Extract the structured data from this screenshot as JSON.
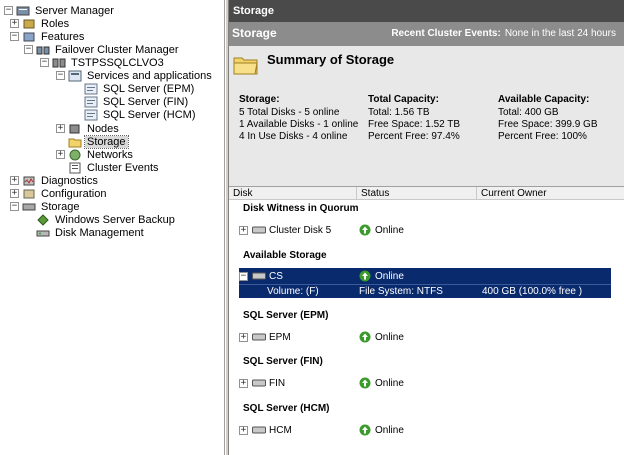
{
  "tree": {
    "items": [
      {
        "label": "Server Manager",
        "expander": "−",
        "icon": "server-manager-icon"
      },
      {
        "label": "Roles",
        "expander": "+",
        "icon": "roles-icon"
      },
      {
        "label": "Features",
        "expander": "−",
        "icon": "features-icon"
      },
      {
        "label": "Failover Cluster Manager",
        "expander": "−",
        "icon": "cluster-manager-icon"
      },
      {
        "label": "TSTPSSQLCLVO3",
        "expander": "−",
        "icon": "cluster-icon"
      },
      {
        "label": "Services and applications",
        "expander": "−",
        "icon": "services-icon"
      },
      {
        "label": "SQL Server (EPM)",
        "expander": "",
        "icon": "service-icon"
      },
      {
        "label": "SQL Server (FIN)",
        "expander": "",
        "icon": "service-icon"
      },
      {
        "label": "SQL Server (HCM)",
        "expander": "",
        "icon": "service-icon"
      },
      {
        "label": "Nodes",
        "expander": "+",
        "icon": "nodes-icon"
      },
      {
        "label": "Storage",
        "expander": "",
        "icon": "storage-icon"
      },
      {
        "label": "Networks",
        "expander": "+",
        "icon": "networks-icon"
      },
      {
        "label": "Cluster Events",
        "expander": "",
        "icon": "events-icon"
      },
      {
        "label": "Diagnostics",
        "expander": "+",
        "icon": "diagnostics-icon"
      },
      {
        "label": "Configuration",
        "expander": "+",
        "icon": "configuration-icon"
      },
      {
        "label": "Storage",
        "expander": "−",
        "icon": "storage-root-icon"
      },
      {
        "label": "Windows Server Backup",
        "expander": "",
        "icon": "backup-icon"
      },
      {
        "label": "Disk Management",
        "expander": "",
        "icon": "disk-management-icon"
      }
    ]
  },
  "pane": {
    "title": "Storage",
    "header": "Storage",
    "events_label": "Recent Cluster Events:",
    "events_value": "None in the last 24 hours",
    "summary_title": "Summary of Storage"
  },
  "summary": {
    "storage": {
      "heading": "Storage:",
      "lines": [
        "5 Total Disks - 5 online",
        "1 Available Disks - 1 online",
        "4 In Use Disks - 4 online"
      ]
    },
    "total": {
      "heading": "Total Capacity:",
      "lines": [
        "Total: 1.56 TB",
        "Free Space: 1.52 TB",
        "Percent Free: 97.4%"
      ]
    },
    "available": {
      "heading": "Available Capacity:",
      "lines": [
        "Total: 400 GB",
        "Free Space: 399.9 GB",
        "Percent Free: 100%"
      ]
    }
  },
  "columns": [
    "Disk",
    "Status",
    "Current Owner"
  ],
  "groups": [
    {
      "title": "Disk Witness in Quorum",
      "disks": [
        {
          "name": "Cluster Disk 5",
          "status": "Online"
        }
      ]
    },
    {
      "title": "Available Storage",
      "disks": [
        {
          "name": "CS",
          "status": "Online",
          "selected": true
        }
      ]
    },
    {
      "title": "SQL Server (EPM)",
      "disks": [
        {
          "name": "EPM",
          "status": "Online"
        }
      ]
    },
    {
      "title": "SQL Server (FIN)",
      "disks": [
        {
          "name": "FIN",
          "status": "Online"
        }
      ]
    },
    {
      "title": "SQL Server (HCM)",
      "disks": [
        {
          "name": "HCM",
          "status": "Online"
        }
      ]
    }
  ],
  "volume": {
    "name": "Volume: (F)",
    "fs": "File System: NTFS",
    "size": "400 GB (100.0% free )"
  },
  "colors": {
    "selection": "#0a2a6e",
    "title_bar": "#4a4a4a",
    "header_bar": "#8c8c8c",
    "online": "#3a9a2a"
  }
}
